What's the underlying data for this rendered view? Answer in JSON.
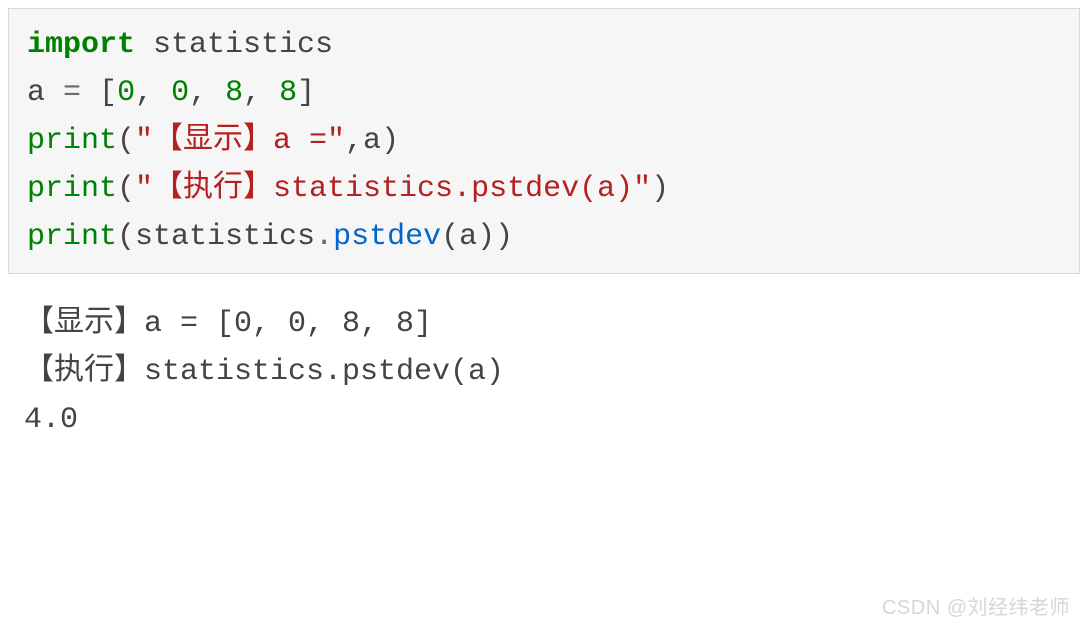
{
  "code": {
    "line1": {
      "import_kw": "import",
      "module": " statistics"
    },
    "line2": {
      "var": "a ",
      "eq": "=",
      "sp": " ",
      "lb": "[",
      "n1": "0",
      "c1": ", ",
      "n2": "0",
      "c2": ", ",
      "n3": "8",
      "c3": ", ",
      "n4": "8",
      "rb": "]"
    },
    "line3": {
      "fn": "print",
      "lp": "(",
      "str": "\"【显示】a =\"",
      "comma": ",a",
      "rp": ")"
    },
    "line4": {
      "fn": "print",
      "lp": "(",
      "str": "\"【执行】statistics.pstdev(a)\"",
      "rp": ")"
    },
    "line5": {
      "fn": "print",
      "lp": "(",
      "obj": "statistics",
      "dot": ".",
      "method": "pstdev",
      "lp2": "(",
      "arg": "a",
      "rp2": ")",
      "rp": ")"
    }
  },
  "output": {
    "line1": "【显示】a = [0, 0, 8, 8]",
    "line2": "【执行】statistics.pstdev(a)",
    "line3": "4.0"
  },
  "watermark": "CSDN @刘经纬老师"
}
